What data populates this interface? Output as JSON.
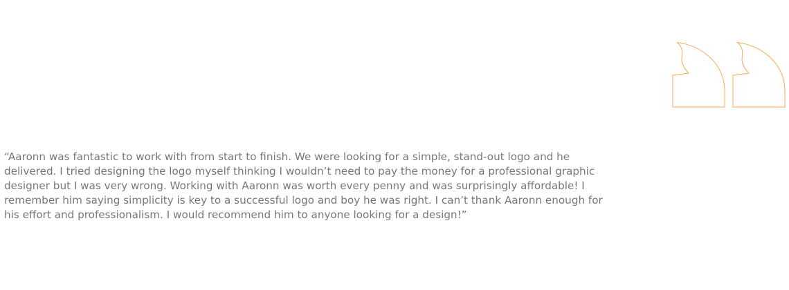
{
  "colors": {
    "accent": "#f7a85a",
    "text": "#777777",
    "background": "#ffffff"
  },
  "testimonial": {
    "quote_icon": "closing-quotation-mark-icon",
    "quote_text": "“Aaronn was fantastic to work with from start to finish. We were looking for a simple, stand-out logo and he delivered. I tried designing the logo myself thinking I wouldn’t need to pay the money for a professional graphic designer but I was very wrong. Working with Aaronn was worth every penny and was surprisingly affordable! I remember him saying simplicity is key to a successful logo and boy he was right. I can’t thank Aaronn enough for his effort and professionalism. I would recommend him to anyone looking for a design!”"
  }
}
